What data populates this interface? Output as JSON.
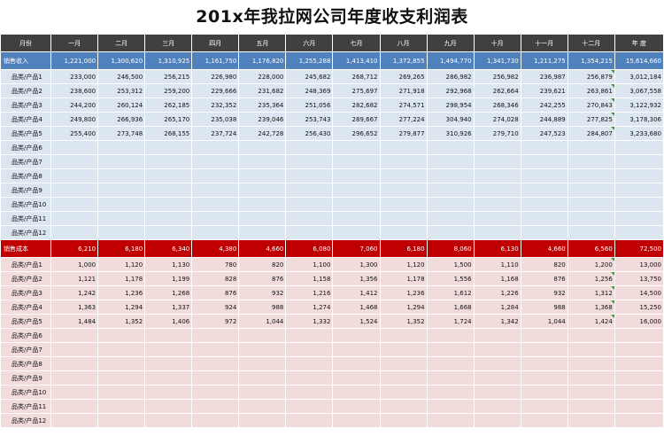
{
  "title": "201x年我拉网公司年度收支利润表",
  "headers": [
    "月份",
    "一月",
    "二月",
    "三月",
    "四月",
    "五月",
    "六月",
    "七月",
    "八月",
    "九月",
    "十月",
    "十一月",
    "十二月",
    "年 度"
  ],
  "revenue": {
    "label": "销售收入",
    "values": [
      "1,221,000",
      "1,300,620",
      "1,310,925",
      "1,161,750",
      "1,176,820",
      "1,255,288",
      "1,413,410",
      "1,372,855",
      "1,494,770",
      "1,341,730",
      "1,211,275",
      "1,354,215",
      "15,614,660"
    ],
    "rows": [
      {
        "label": "品类/产品1",
        "values": [
          "233,000",
          "246,500",
          "256,215",
          "226,980",
          "228,000",
          "245,682",
          "268,712",
          "269,265",
          "286,982",
          "256,982",
          "236,987",
          "256,879",
          "3,012,184"
        ]
      },
      {
        "label": "品类/产品2",
        "values": [
          "238,600",
          "253,312",
          "259,200",
          "229,666",
          "231,682",
          "248,369",
          "275,697",
          "271,918",
          "292,968",
          "262,664",
          "239,621",
          "263,861",
          "3,067,558"
        ]
      },
      {
        "label": "品类/产品3",
        "values": [
          "244,200",
          "260,124",
          "262,185",
          "232,352",
          "235,364",
          "251,056",
          "282,682",
          "274,571",
          "298,954",
          "268,346",
          "242,255",
          "270,843",
          "3,122,932"
        ]
      },
      {
        "label": "品类/产品4",
        "values": [
          "249,800",
          "266,936",
          "265,170",
          "235,038",
          "239,046",
          "253,743",
          "289,667",
          "277,224",
          "304,940",
          "274,028",
          "244,889",
          "277,825",
          "3,178,306"
        ]
      },
      {
        "label": "品类/产品5",
        "values": [
          "255,400",
          "273,748",
          "268,155",
          "237,724",
          "242,728",
          "256,430",
          "296,652",
          "279,877",
          "310,926",
          "279,710",
          "247,523",
          "284,807",
          "3,233,680"
        ]
      },
      {
        "label": "品类/产品6",
        "values": [
          "",
          "",
          "",
          "",
          "",
          "",
          "",
          "",
          "",
          "",
          "",
          "",
          ""
        ]
      },
      {
        "label": "品类/产品7",
        "values": [
          "",
          "",
          "",
          "",
          "",
          "",
          "",
          "",
          "",
          "",
          "",
          "",
          ""
        ]
      },
      {
        "label": "品类/产品8",
        "values": [
          "",
          "",
          "",
          "",
          "",
          "",
          "",
          "",
          "",
          "",
          "",
          "",
          ""
        ]
      },
      {
        "label": "品类/产品9",
        "values": [
          "",
          "",
          "",
          "",
          "",
          "",
          "",
          "",
          "",
          "",
          "",
          "",
          ""
        ]
      },
      {
        "label": "品类/产品10",
        "values": [
          "",
          "",
          "",
          "",
          "",
          "",
          "",
          "",
          "",
          "",
          "",
          "",
          ""
        ]
      },
      {
        "label": "品类/产品11",
        "values": [
          "",
          "",
          "",
          "",
          "",
          "",
          "",
          "",
          "",
          "",
          "",
          "",
          ""
        ]
      },
      {
        "label": "品类/产品12",
        "values": [
          "",
          "",
          "",
          "",
          "",
          "",
          "",
          "",
          "",
          "",
          "",
          "",
          ""
        ]
      }
    ]
  },
  "cost": {
    "label": "销售成本",
    "values": [
      "6,210",
      "6,180",
      "6,340",
      "4,380",
      "4,660",
      "6,080",
      "7,060",
      "6,180",
      "8,060",
      "6,130",
      "4,660",
      "6,560",
      "72,500"
    ],
    "rows": [
      {
        "label": "品类/产品1",
        "values": [
          "1,000",
          "1,120",
          "1,130",
          "780",
          "820",
          "1,100",
          "1,300",
          "1,120",
          "1,500",
          "1,110",
          "820",
          "1,200",
          "13,000"
        ]
      },
      {
        "label": "品类/产品2",
        "values": [
          "1,121",
          "1,178",
          "1,199",
          "828",
          "876",
          "1,158",
          "1,356",
          "1,178",
          "1,556",
          "1,168",
          "876",
          "1,256",
          "13,750"
        ]
      },
      {
        "label": "品类/产品3",
        "values": [
          "1,242",
          "1,236",
          "1,268",
          "876",
          "932",
          "1,216",
          "1,412",
          "1,236",
          "1,612",
          "1,226",
          "932",
          "1,312",
          "14,500"
        ]
      },
      {
        "label": "品类/产品4",
        "values": [
          "1,363",
          "1,294",
          "1,337",
          "924",
          "988",
          "1,274",
          "1,468",
          "1,294",
          "1,668",
          "1,284",
          "988",
          "1,368",
          "15,250"
        ]
      },
      {
        "label": "品类/产品5",
        "values": [
          "1,484",
          "1,352",
          "1,406",
          "972",
          "1,044",
          "1,332",
          "1,524",
          "1,352",
          "1,724",
          "1,342",
          "1,044",
          "1,424",
          "16,000"
        ]
      },
      {
        "label": "品类/产品6",
        "values": [
          "",
          "",
          "",
          "",
          "",
          "",
          "",
          "",
          "",
          "",
          "",
          "",
          ""
        ]
      },
      {
        "label": "品类/产品7",
        "values": [
          "",
          "",
          "",
          "",
          "",
          "",
          "",
          "",
          "",
          "",
          "",
          "",
          ""
        ]
      },
      {
        "label": "品类/产品8",
        "values": [
          "",
          "",
          "",
          "",
          "",
          "",
          "",
          "",
          "",
          "",
          "",
          "",
          ""
        ]
      },
      {
        "label": "品类/产品9",
        "values": [
          "",
          "",
          "",
          "",
          "",
          "",
          "",
          "",
          "",
          "",
          "",
          "",
          ""
        ]
      },
      {
        "label": "品类/产品10",
        "values": [
          "",
          "",
          "",
          "",
          "",
          "",
          "",
          "",
          "",
          "",
          "",
          "",
          ""
        ]
      },
      {
        "label": "品类/产品11",
        "values": [
          "",
          "",
          "",
          "",
          "",
          "",
          "",
          "",
          "",
          "",
          "",
          "",
          ""
        ]
      },
      {
        "label": "品类/产品12",
        "values": [
          "",
          "",
          "",
          "",
          "",
          "",
          "",
          "",
          "",
          "",
          "",
          "",
          ""
        ]
      }
    ]
  }
}
